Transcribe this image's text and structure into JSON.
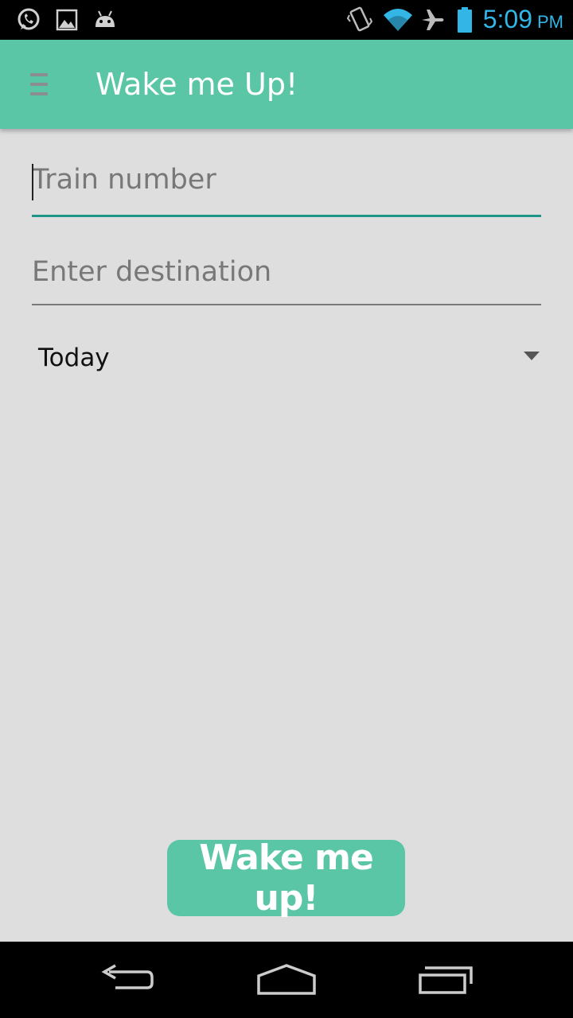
{
  "status_bar": {
    "time": "5:09",
    "ampm": "PM",
    "icons": [
      "whatsapp-icon",
      "image-icon",
      "android-icon",
      "vibrate-icon",
      "wifi-icon",
      "airplane-icon",
      "battery-icon"
    ],
    "accent_color": "#33b5e5"
  },
  "app_bar": {
    "title": "Wake me Up!",
    "color": "#5bc6a6"
  },
  "form": {
    "train_number": {
      "value": "",
      "placeholder": "Train number",
      "focused": true
    },
    "destination": {
      "value": "",
      "placeholder": "Enter destination"
    },
    "day_select": {
      "selected": "Today"
    }
  },
  "action": {
    "label": "Wake me up!"
  },
  "nav_bar": {
    "buttons": [
      "back-icon",
      "home-icon",
      "recents-icon"
    ]
  }
}
